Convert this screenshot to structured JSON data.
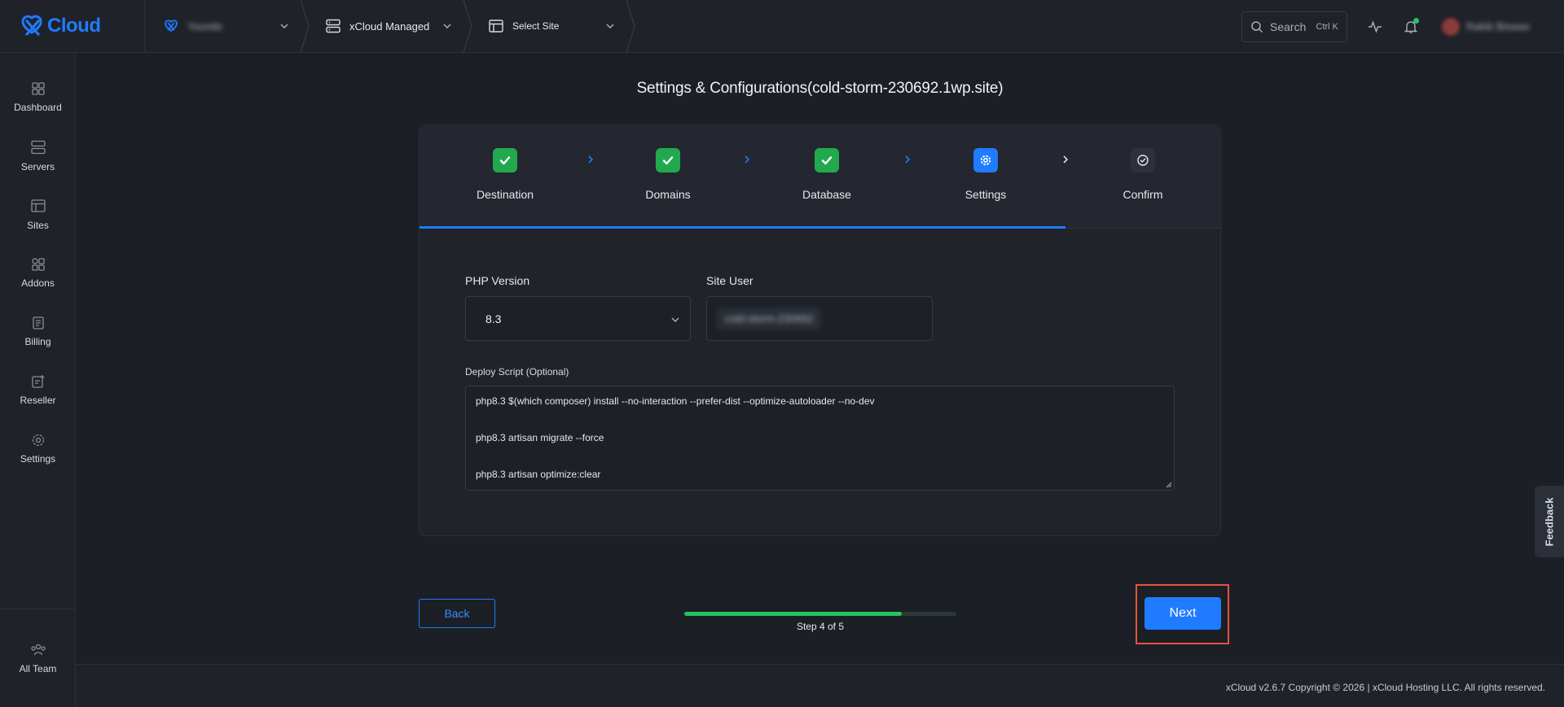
{
  "brand": {
    "name": "Cloud",
    "accent": "#1f7bff"
  },
  "topbar": {
    "workspace": "Yoonite",
    "server": "xCloud Managed",
    "site": "Select Site",
    "search": {
      "label": "Search",
      "shortcut": "Ctrl K"
    },
    "user": "Rakib Biswas"
  },
  "sidebar": {
    "items": [
      {
        "label": "Dashboard",
        "icon": "dashboard-icon"
      },
      {
        "label": "Servers",
        "icon": "servers-icon"
      },
      {
        "label": "Sites",
        "icon": "sites-icon"
      },
      {
        "label": "Addons",
        "icon": "addons-icon"
      },
      {
        "label": "Billing",
        "icon": "billing-icon"
      },
      {
        "label": "Reseller",
        "icon": "reseller-icon"
      },
      {
        "label": "Settings",
        "icon": "settings-icon"
      }
    ],
    "bottom": {
      "label": "All Team",
      "icon": "team-icon"
    }
  },
  "page": {
    "title": "Settings & Configurations(cold-storm-230692.1wp.site)"
  },
  "steps": [
    {
      "label": "Destination",
      "state": "done"
    },
    {
      "label": "Domains",
      "state": "done"
    },
    {
      "label": "Database",
      "state": "done"
    },
    {
      "label": "Settings",
      "state": "active"
    },
    {
      "label": "Confirm",
      "state": "pending"
    }
  ],
  "form": {
    "php_version_label": "PHP Version",
    "php_version_value": "8.3",
    "site_user_label": "Site User",
    "site_user_value": "cold-storm-230692",
    "deploy_label": "Deploy Script (Optional)",
    "deploy_lines": [
      "php8.3 $(which composer) install --no-interaction --prefer-dist --optimize-autoloader --no-dev",
      "php8.3 artisan migrate --force",
      "php8.3 artisan optimize:clear"
    ]
  },
  "wizard": {
    "back_label": "Back",
    "next_label": "Next",
    "step_text": "Step 4 of 5",
    "progress": 0.8
  },
  "footer": {
    "copyright": "xCloud v2.6.7 Copyright © 2026 | xCloud Hosting LLC. All rights reserved."
  },
  "feedback_label": "Feedback",
  "colors": {
    "success": "#22c55e",
    "primary": "#1f7bff",
    "highlight": "#e5533d"
  }
}
